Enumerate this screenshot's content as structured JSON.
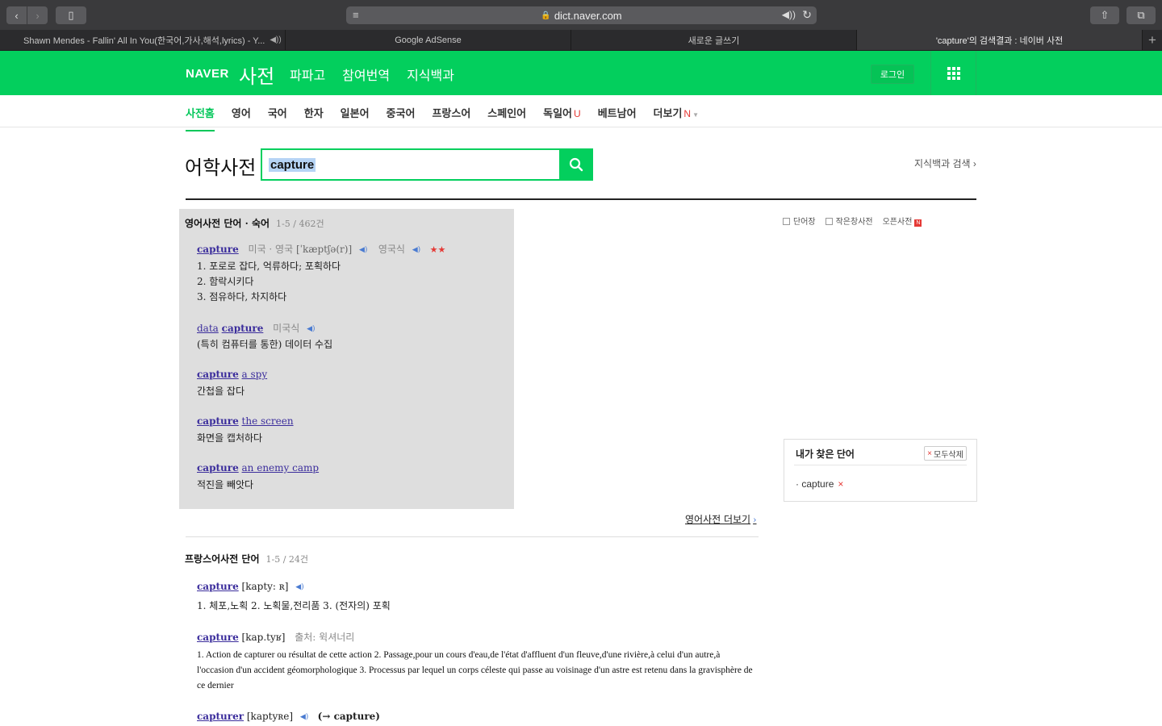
{
  "browser": {
    "url": "dict.naver.com",
    "tabs": [
      {
        "label": "Shawn Mendes - Fallin' All In You(한국어,가사,해석,lyrics) - Y...",
        "audio": "◀))"
      },
      {
        "label": "Google AdSense"
      },
      {
        "label": "새로운 글쓰기"
      },
      {
        "label": "'capture'의 검색결과 : 네이버 사전"
      }
    ]
  },
  "header": {
    "logo": "NAVER",
    "title": "사전",
    "links": [
      "파파고",
      "참여번역",
      "지식백과"
    ],
    "login": "로그인"
  },
  "categories": [
    {
      "label": "사전홈",
      "active": true
    },
    {
      "label": "영어"
    },
    {
      "label": "국어"
    },
    {
      "label": "한자"
    },
    {
      "label": "일본어"
    },
    {
      "label": "중국어"
    },
    {
      "label": "프랑스어"
    },
    {
      "label": "스페인어"
    },
    {
      "label": "독일어",
      "badge": "U"
    },
    {
      "label": "베트남어"
    },
    {
      "label": "더보기",
      "badge": "N"
    }
  ],
  "search": {
    "title": "어학사전",
    "query": "capture",
    "kb_search": "지식백과 검색 ›"
  },
  "english": {
    "heading": "영어사전 단어 · 숙어",
    "count": "1-5 / 462건",
    "e1": {
      "word": "capture",
      "pron_label": "미국 · 영국",
      "pron": "[ˈkæptʃə(r)]",
      "alt": "영국식",
      "stars": "★★",
      "meanings": [
        "1. 포로로 잡다, 억류하다; 포획하다",
        "2. 함락시키다",
        "3. 점유하다, 차지하다"
      ]
    },
    "e2": {
      "word_pre": "data",
      "word": "capture",
      "pron_label": "미국식",
      "meaning": "(특히 컴퓨터를 통한) 데이터 수집"
    },
    "e3": {
      "word": "capture",
      "rest": "a spy",
      "meaning": "간첩을 잡다"
    },
    "e4": {
      "word": "capture",
      "rest": "the screen",
      "meaning": "화면을 캡처하다"
    },
    "e5": {
      "word": "capture",
      "rest": "an enemy camp",
      "meaning": "적진을 빼앗다"
    },
    "more": "영어사전 더보기"
  },
  "tools": {
    "wordbook": "단어장",
    "mini": "작은창사전",
    "open": "오픈사전",
    "open_badge": "N"
  },
  "recent": {
    "title": "내가 찾은 단어",
    "delete_all": "모두삭제",
    "items": [
      "capture"
    ]
  },
  "french": {
    "heading": "프랑스어사전 단어",
    "count": "1-5 / 24건",
    "f1": {
      "word": "capture",
      "pron": "[kapty: ʀ]",
      "meaning": "1. 체포,노획 2. 노획물,전리품 3. (전자의) 포획"
    },
    "f2": {
      "word": "capture",
      "pron": "[kap.tyʁ]",
      "source": "출처: 윅셔너리",
      "meaning": "1. Action de capturer ou résultat de cette action 2. Passage,pour un cours d'eau,de l'état d'affluent d'un fleuve,d'une rivière,à celui d'un autre,à l'occasion d'un accident géomorphologique 3. Processus par lequel un corps céleste qui passe au voisinage d'un astre est retenu dans la gravisphère de ce dernier"
    },
    "f3": {
      "word": "capturer",
      "pron": "[kaptyʀe]",
      "ref": "(→ capture)"
    }
  }
}
